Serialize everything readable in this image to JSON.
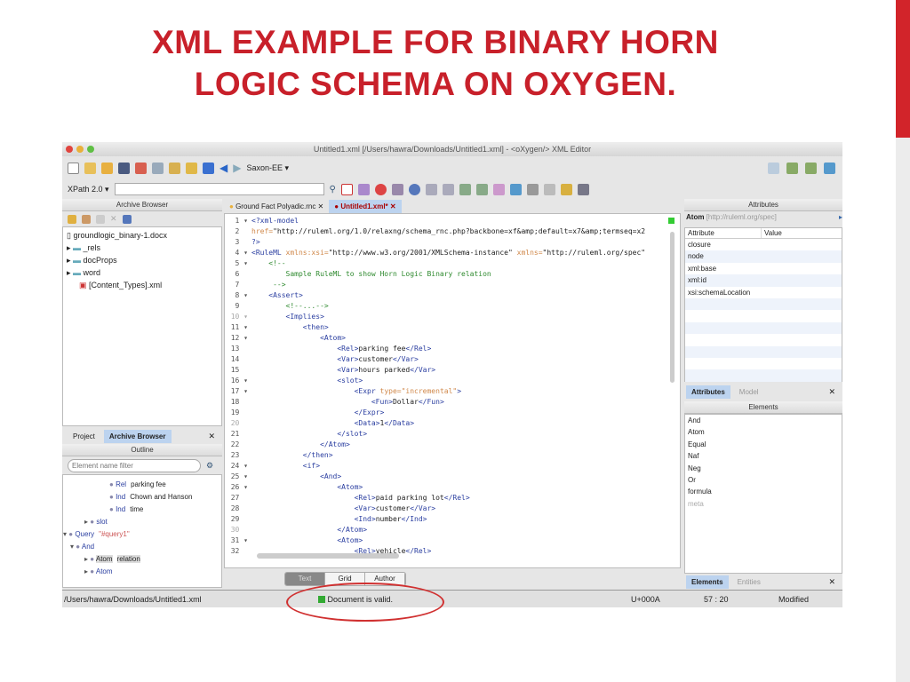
{
  "slide": {
    "title_line1": "XML EXAMPLE FOR BINARY HORN",
    "title_line2": "LOGIC SCHEMA ON OXYGEN."
  },
  "window": {
    "title": "Untitled1.xml [/Users/hawra/Downloads/Untitled1.xml] - <oXygen/> XML Editor"
  },
  "toolbar": {
    "transformer": "Saxon-EE ▾",
    "xpath_label": "XPath 2.0 ▾",
    "xpath_value": ""
  },
  "archive": {
    "title": "Archive Browser",
    "items": [
      "groundlogic_binary-1.docx",
      "_rels",
      "docProps",
      "word",
      "[Content_Types].xml"
    ]
  },
  "left_tabs": {
    "project": "Project",
    "archive": "Archive Browser"
  },
  "outline": {
    "title": "Outline",
    "filter_placeholder": "Element name filter",
    "items": [
      {
        "kind": "Rel",
        "text": "parking fee"
      },
      {
        "kind": "Ind",
        "text": "Chown and Hanson"
      },
      {
        "kind": "Ind",
        "text": "time"
      },
      {
        "kind": "slot",
        "text": ""
      },
      {
        "kind": "Query",
        "text": "\"#query1\""
      },
      {
        "kind": "And",
        "text": ""
      },
      {
        "kind": "Atom",
        "text": "relation"
      },
      {
        "kind": "Atom",
        "text": ""
      }
    ]
  },
  "editor": {
    "tabs": [
      "Ground Fact Polyadic.rnc",
      "Untitled1.xml*"
    ],
    "lines": [
      [
        [
          "tag",
          "<?xml-model"
        ]
      ],
      [
        [
          "att",
          "href="
        ],
        [
          "val",
          "\"http://ruleml.org/1.0/relaxng/schema_rnc.php?backbone=xf&amp;default=x7&amp;termseq=x2"
        ]
      ],
      [
        [
          "tag",
          "?>"
        ]
      ],
      [
        [
          "tag",
          "<RuleML "
        ],
        [
          "att",
          "xmlns:xsi="
        ],
        [
          "val",
          "\"http://www.w3.org/2001/XMLSchema-instance\" "
        ],
        [
          "att",
          "xmlns="
        ],
        [
          "val",
          "\"http://ruleml.org/spec\""
        ]
      ],
      [
        [
          "cm",
          "    <!--"
        ]
      ],
      [
        [
          "cm",
          "        Sample RuleML to show Horn Logic Binary relation"
        ]
      ],
      [
        [
          "cm",
          "     -->"
        ]
      ],
      [
        [
          "tag",
          "    <Assert>"
        ]
      ],
      [
        [
          "cm",
          "        <!--...-->"
        ]
      ],
      [
        [
          "tag",
          "        <Implies>"
        ]
      ],
      [
        [
          "tag",
          "            <then>"
        ]
      ],
      [
        [
          "tag",
          "                <Atom>"
        ]
      ],
      [
        [
          "tag",
          "                    <Rel>"
        ],
        [
          "tx",
          "parking fee"
        ],
        [
          "tag",
          "</Rel>"
        ]
      ],
      [
        [
          "tag",
          "                    <Var>"
        ],
        [
          "tx",
          "customer"
        ],
        [
          "tag",
          "</Var>"
        ]
      ],
      [
        [
          "tag",
          "                    <Var>"
        ],
        [
          "tx",
          "hours parked"
        ],
        [
          "tag",
          "</Var>"
        ]
      ],
      [
        [
          "tag",
          "                    <slot>"
        ]
      ],
      [
        [
          "tag",
          "                        <Expr "
        ],
        [
          "att",
          "type="
        ],
        [
          "att",
          "\"incremental\""
        ],
        [
          "tag",
          ">"
        ]
      ],
      [
        [
          "tag",
          "                            <Fun>"
        ],
        [
          "tx",
          "Dollar"
        ],
        [
          "tag",
          "</Fun>"
        ]
      ],
      [
        [
          "tag",
          "                        </Expr>"
        ]
      ],
      [
        [
          "tag",
          "                        <Data>"
        ],
        [
          "tx",
          "1"
        ],
        [
          "tag",
          "</Data>"
        ]
      ],
      [
        [
          "tag",
          "                    </slot>"
        ]
      ],
      [
        [
          "tag",
          "                </Atom>"
        ]
      ],
      [
        [
          "tag",
          "            </then>"
        ]
      ],
      [
        [
          "tag",
          "            <if>"
        ]
      ],
      [
        [
          "tag",
          "                <And>"
        ]
      ],
      [
        [
          "tag",
          "                    <Atom>"
        ]
      ],
      [
        [
          "tag",
          "                        <Rel>"
        ],
        [
          "tx",
          "paid parking lot"
        ],
        [
          "tag",
          "</Rel>"
        ]
      ],
      [
        [
          "tag",
          "                        <Var>"
        ],
        [
          "tx",
          "customer"
        ],
        [
          "tag",
          "</Var>"
        ]
      ],
      [
        [
          "tag",
          "                        <Ind>"
        ],
        [
          "tx",
          "number"
        ],
        [
          "tag",
          "</Ind>"
        ]
      ],
      [
        [
          "tag",
          "                    </Atom>"
        ]
      ],
      [
        [
          "tag",
          "                    <Atom>"
        ]
      ],
      [
        [
          "tag",
          "                        <Rel>"
        ],
        [
          "tx",
          "vehicle"
        ],
        [
          "tag",
          "</Rel>"
        ]
      ]
    ],
    "fold": [
      1,
      4,
      5,
      8,
      10,
      11,
      12,
      16,
      17,
      24,
      25,
      26,
      31
    ],
    "modes": [
      "Text",
      "Grid",
      "Author"
    ]
  },
  "attributes": {
    "title": "Attributes",
    "element": "Atom",
    "ns": "[http://ruleml.org/spec]",
    "col_attr": "Attribute",
    "col_value": "Value",
    "rows": [
      "closure",
      "node",
      "xml:base",
      "xml:id",
      "xsi:schemaLocation"
    ],
    "tabs": [
      "Attributes",
      "Model"
    ]
  },
  "elements": {
    "title": "Elements",
    "items": [
      "And",
      "Atom",
      "Equal",
      "Naf",
      "Neg",
      "Or",
      "formula",
      "meta"
    ],
    "tabs": [
      "Elements",
      "Entities"
    ]
  },
  "status": {
    "path": "/Users/hawra/Downloads/Untitled1.xml",
    "validity": "Document is valid.",
    "unicode": "U+000A",
    "position": "57 : 20",
    "state": "Modified"
  }
}
